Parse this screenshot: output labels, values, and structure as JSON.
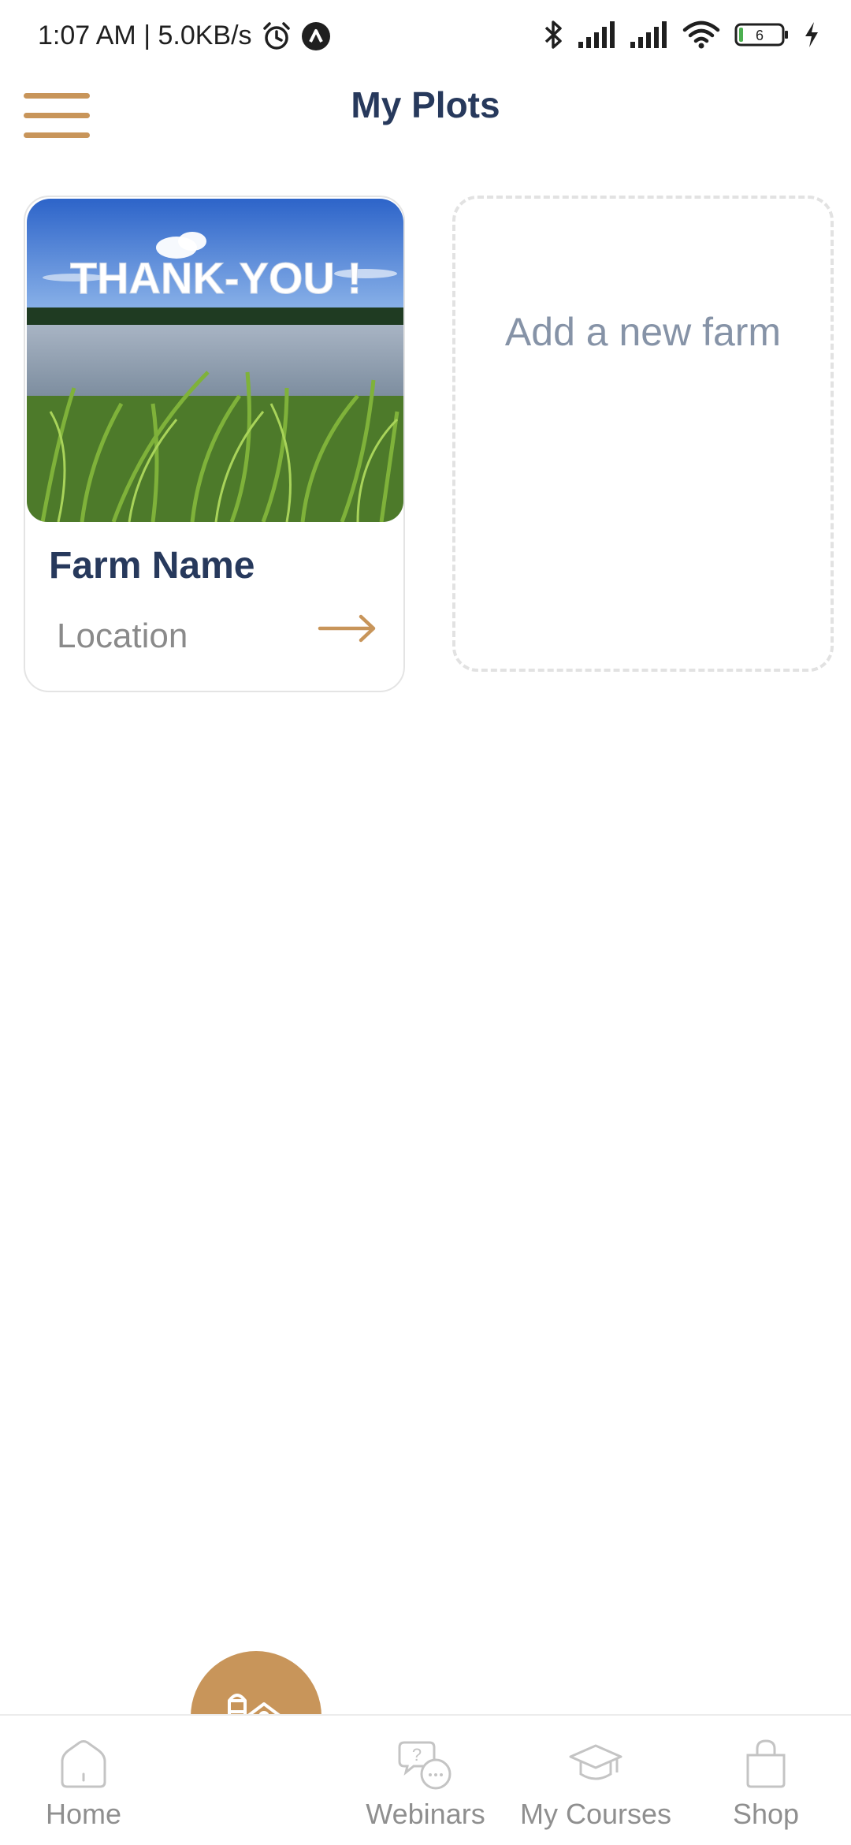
{
  "status_bar": {
    "time_speed": "1:07 AM | 5.0KB/s",
    "battery_level": "6",
    "icons": [
      "alarm-icon",
      "app-notification-icon",
      "bluetooth-icon",
      "signal-icon",
      "signal-icon",
      "wifi-icon",
      "battery-icon",
      "charging-icon"
    ]
  },
  "header": {
    "title": "My Plots",
    "menu_icon": "hamburger-menu-icon"
  },
  "farm_card": {
    "image_caption": "THANK-YOU !",
    "name": "Farm Name",
    "location": "Location",
    "arrow_icon": "arrow-right-icon"
  },
  "add_farm": {
    "label": "Add a new farm"
  },
  "bottom_nav": {
    "fab_icon": "farm-house-icon",
    "items": [
      {
        "label": "Home",
        "icon": "home-icon"
      },
      {
        "label": "Webinars",
        "icon": "chat-question-icon"
      },
      {
        "label": "My Courses",
        "icon": "graduation-cap-icon"
      },
      {
        "label": "Shop",
        "icon": "shopping-bag-icon"
      }
    ]
  },
  "colors": {
    "accent": "#c8955a",
    "title": "#27395c",
    "muted": "#8f8f8f",
    "add_label": "#8693a7"
  }
}
